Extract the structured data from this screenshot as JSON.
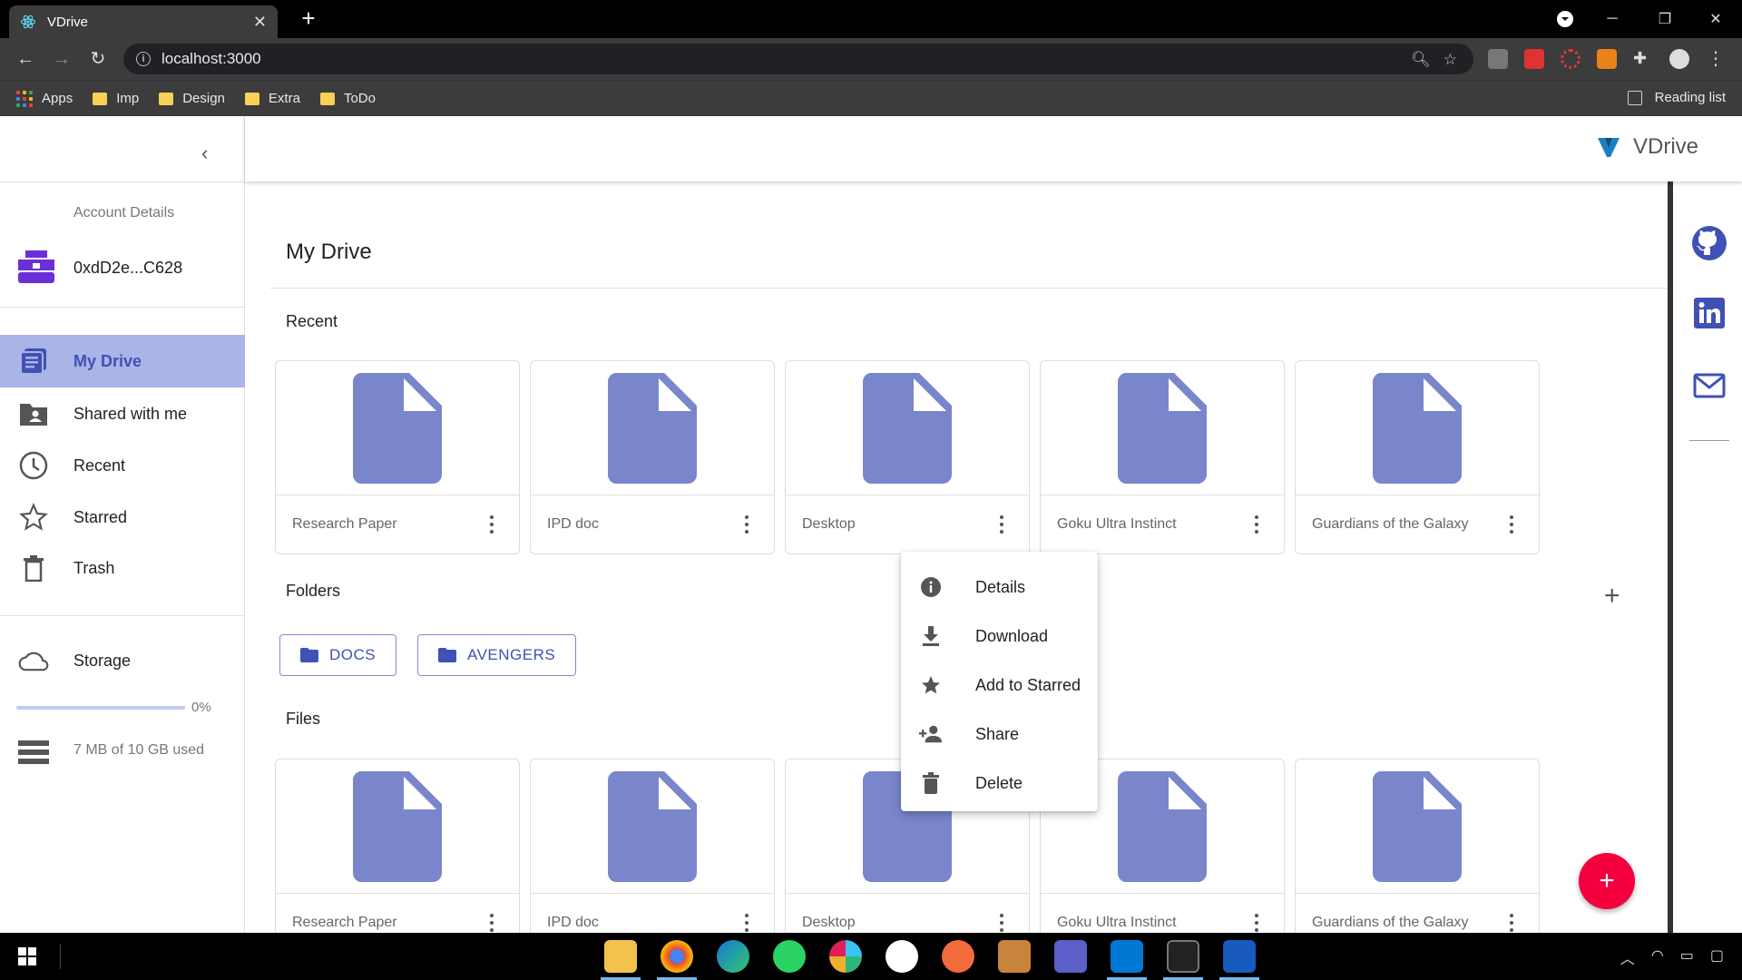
{
  "browser": {
    "tab_title": "VDrive",
    "tab_close": "✕",
    "new_tab": "+",
    "url": "localhost:3000",
    "bookmarks": [
      {
        "label": "Apps"
      },
      {
        "label": "Imp"
      },
      {
        "label": "Design"
      },
      {
        "label": "Extra"
      },
      {
        "label": "ToDo"
      }
    ],
    "reading_list": "Reading list"
  },
  "app": {
    "brand": "VDrive",
    "accent": "#3f51b5",
    "file_color": "#7986cb"
  },
  "sidebar": {
    "account_label": "Account Details",
    "account_address": "0xdD2e...C628",
    "nav": [
      {
        "label": "My Drive",
        "icon": "drive-icon",
        "active": true
      },
      {
        "label": "Shared with me",
        "icon": "shared-folder-icon"
      },
      {
        "label": "Recent",
        "icon": "clock-icon"
      },
      {
        "label": "Starred",
        "icon": "star-icon"
      },
      {
        "label": "Trash",
        "icon": "trash-icon"
      }
    ],
    "storage_label": "Storage",
    "storage_percent": "0%",
    "storage_fraction": 0.0,
    "storage_used": "7 MB of 10 GB used"
  },
  "main": {
    "title": "My Drive",
    "recent_label": "Recent",
    "folders_label": "Folders",
    "files_label": "Files",
    "recent": [
      {
        "name": "Research Paper"
      },
      {
        "name": "IPD doc"
      },
      {
        "name": "Desktop"
      },
      {
        "name": "Goku Ultra Instinct"
      },
      {
        "name": "Guardians of the Galaxy"
      }
    ],
    "folders": [
      {
        "name": "DOCS"
      },
      {
        "name": "AVENGERS"
      }
    ],
    "files": [
      {
        "name": "Research Paper"
      },
      {
        "name": "IPD doc"
      },
      {
        "name": "Desktop"
      },
      {
        "name": "Goku Ultra Instinct"
      },
      {
        "name": "Guardians of the Galaxy"
      }
    ]
  },
  "context_menu": {
    "items": [
      {
        "label": "Details",
        "icon": "info-icon"
      },
      {
        "label": "Download",
        "icon": "download-icon"
      },
      {
        "label": "Add to Starred",
        "icon": "star-filled-icon"
      },
      {
        "label": "Share",
        "icon": "person-add-icon"
      },
      {
        "label": "Delete",
        "icon": "delete-icon"
      }
    ]
  },
  "fab": {
    "label": "+"
  },
  "add_folder": {
    "label": "+"
  }
}
